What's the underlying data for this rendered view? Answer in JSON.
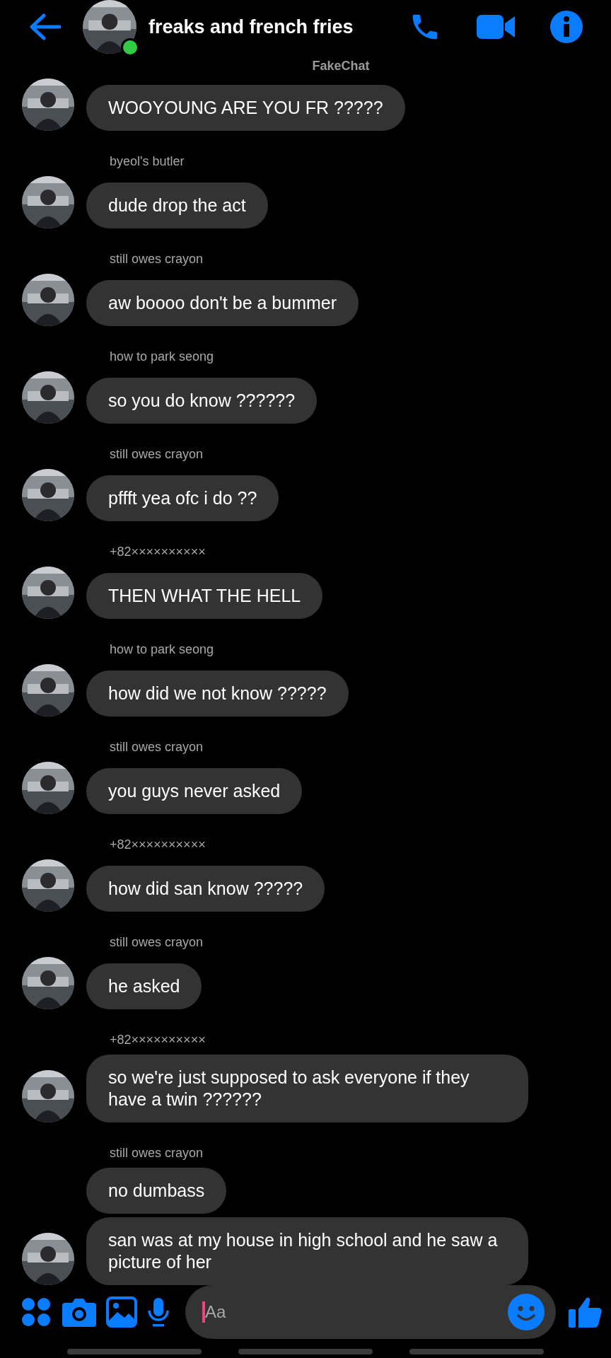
{
  "header": {
    "title": "freaks and french fries",
    "online": true
  },
  "watermark_label": "FakeChat",
  "messages": [
    {
      "bubbles": [
        "WOOYOUNG ARE YOU FR ?????"
      ]
    },
    {
      "sender": "byeol's butler",
      "bubbles": [
        "dude drop the act"
      ]
    },
    {
      "sender": "still owes crayon",
      "bubbles": [
        "aw boooo don't be a bummer"
      ]
    },
    {
      "sender": "how to park seong",
      "bubbles": [
        "so you do know ??????"
      ]
    },
    {
      "sender": "still owes crayon",
      "bubbles": [
        "pffft yea ofc i do ??"
      ]
    },
    {
      "sender": "+82××××××××××",
      "bubbles": [
        "THEN WHAT THE HELL"
      ]
    },
    {
      "sender": "how to park seong",
      "bubbles": [
        "how did we not know ?????"
      ]
    },
    {
      "sender": "still owes crayon",
      "bubbles": [
        "you guys never asked"
      ]
    },
    {
      "sender": "+82××××××××××",
      "bubbles": [
        "how did san know ?????"
      ]
    },
    {
      "sender": "still owes crayon",
      "bubbles": [
        "he asked"
      ]
    },
    {
      "sender": "+82××××××××××",
      "bubbles": [
        "so we're just supposed to ask everyone if they have a twin ??????"
      ]
    },
    {
      "sender": "still owes crayon",
      "bubbles": [
        "no dumbass",
        "san was at my house in high school and he saw a picture of her"
      ]
    }
  ],
  "composer": {
    "placeholder": "Aa"
  }
}
